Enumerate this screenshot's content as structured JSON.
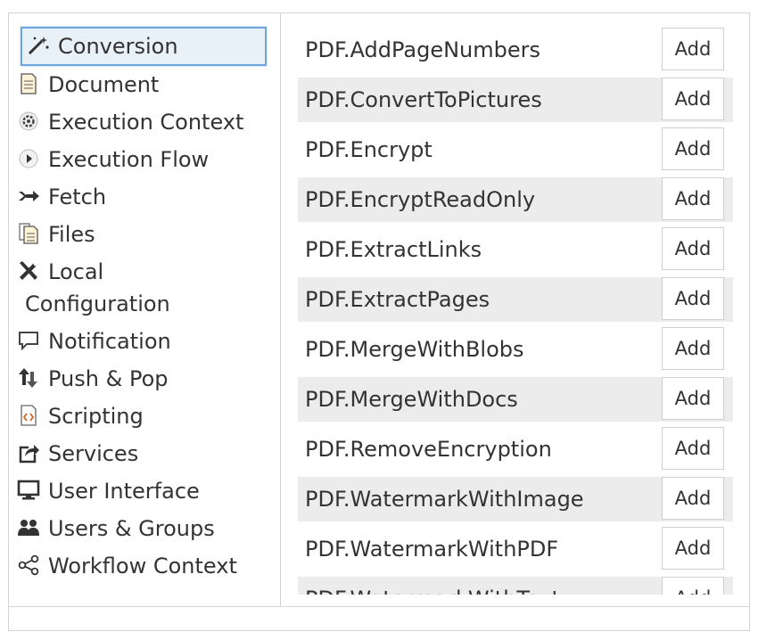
{
  "categories": [
    {
      "label": "Conversion",
      "icon": "magic-wand-icon"
    },
    {
      "label": "Document",
      "icon": "document-icon"
    },
    {
      "label": "Execution Context",
      "icon": "gear-icon"
    },
    {
      "label": "Execution Flow",
      "icon": "play-icon"
    },
    {
      "label": "Fetch",
      "icon": "fetch-arrow-icon"
    },
    {
      "label": "Files",
      "icon": "files-icon"
    },
    {
      "label": "Local",
      "label2": "Configuration",
      "icon": "tools-icon"
    },
    {
      "label": "Notification",
      "icon": "speech-bubble-icon"
    },
    {
      "label": "Push & Pop",
      "icon": "up-down-arrows-icon"
    },
    {
      "label": "Scripting",
      "icon": "script-icon"
    },
    {
      "label": "Services",
      "icon": "share-box-icon"
    },
    {
      "label": "User Interface",
      "icon": "monitor-icon"
    },
    {
      "label": "Users & Groups",
      "icon": "users-icon"
    },
    {
      "label": "Workflow Context",
      "icon": "share-nodes-icon"
    }
  ],
  "selected_category": "Conversion",
  "add_label": "Add",
  "actions": [
    "PDF.AddPageNumbers",
    "PDF.ConvertToPictures",
    "PDF.Encrypt",
    "PDF.EncryptReadOnly",
    "PDF.ExtractLinks",
    "PDF.ExtractPages",
    "PDF.MergeWithBlobs",
    "PDF.MergeWithDocs",
    "PDF.RemoveEncryption",
    "PDF.WatermarkWithImage",
    "PDF.WatermarkWithPDF",
    "PDF.WatermarkWithText"
  ],
  "colors": {
    "selected_border": "#6fa4dd",
    "selected_bg": "#e8f0f8",
    "row_shade": "#ececec",
    "border": "#d4d4d4"
  }
}
